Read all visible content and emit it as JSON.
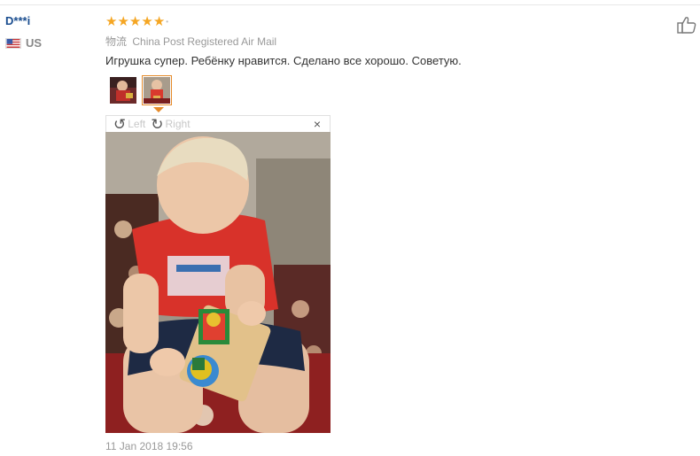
{
  "review": {
    "user": "D***i",
    "country": "US",
    "rating_icon": "star-5",
    "shipping_label": "物流",
    "shipping_method": "China Post Registered Air Mail",
    "comment": "Игрушка супер. Ребёнку нравится. Сделано все хорошо. Советую.",
    "date": "11 Jan 2018 19:56"
  },
  "viewer": {
    "rotate_left": "Left",
    "rotate_right": "Right",
    "close": "×"
  },
  "colors": {
    "accent": "#e58a2a",
    "star": "#f5a623",
    "user": "#1a4d8f"
  }
}
